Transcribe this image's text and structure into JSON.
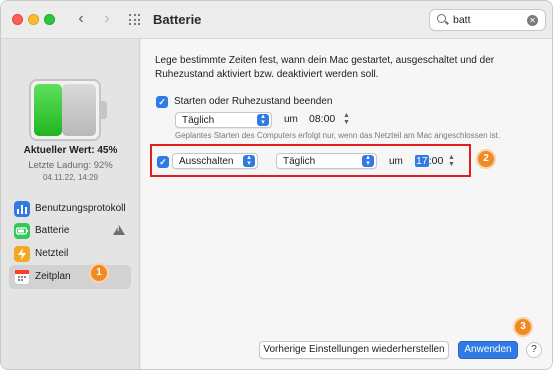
{
  "window": {
    "title": "Batterie"
  },
  "search": {
    "value": "batt"
  },
  "sidebar": {
    "battery_level": 0.45,
    "current_value": "Aktueller Wert: 45%",
    "last_charge": "Letzte Ladung: 92%",
    "last_charge_date": "04.11.22, 14:29",
    "items": [
      {
        "label": "Benutzungsprotokoll",
        "icon": "bar-chart-icon",
        "color": "#2f7ae5"
      },
      {
        "label": "Batterie",
        "icon": "battery-icon",
        "color": "#34c759",
        "warning": true
      },
      {
        "label": "Netzteil",
        "icon": "bolt-icon",
        "color": "#f5a623"
      },
      {
        "label": "Zeitplan",
        "icon": "calendar-icon",
        "color": "#ffffff",
        "selected": true
      }
    ]
  },
  "main": {
    "intro": "Lege bestimmte Zeiten fest, wann dein Mac gestartet, ausgeschaltet und der Ruhezustand aktiviert bzw. deaktiviert werden soll.",
    "row1": {
      "checkbox_label": "Starten oder Ruhezustand beenden",
      "checked": true,
      "frequency": "Täglich",
      "um": "um",
      "time": "08:00"
    },
    "hint": "Geplantes Starten des Computers erfolgt nur, wenn das Netzteil am Mac angeschlossen ist.",
    "row2": {
      "checked": true,
      "action": "Ausschalten",
      "frequency": "Täglich",
      "um": "um",
      "hour": "17",
      "minute": ":00"
    }
  },
  "buttons": {
    "restore": "Vorherige Einstellungen wiederherstellen",
    "apply": "Anwenden",
    "help": "?"
  },
  "callouts": [
    "1",
    "2",
    "3"
  ],
  "colors": {
    "accent": "#2f7ae5",
    "highlight": "#e11e1e",
    "callout": "#f08a24"
  }
}
